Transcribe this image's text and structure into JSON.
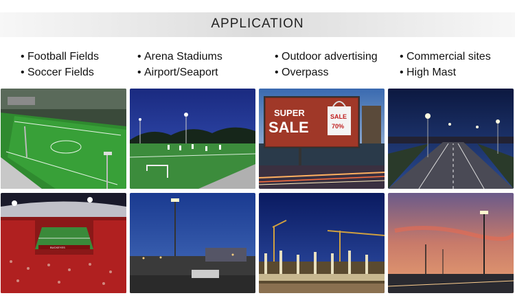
{
  "header": {
    "title": "APPLICATION"
  },
  "uses": {
    "col1": [
      "Football Fields",
      "Soccer Fields"
    ],
    "col2": [
      "Arena Stadiums",
      "Airport/Seaport"
    ],
    "col3": [
      "Outdoor advertising",
      "Overpass"
    ],
    "col4": [
      "Commercial sites",
      "High Mast"
    ]
  },
  "billboard": {
    "line1": "SUPER",
    "line2": "SALE",
    "bag_line1": "SALE",
    "bag_line2": "70%"
  },
  "stadium_sign": "BUCKEYES",
  "icons": {
    "bullet": "•"
  }
}
